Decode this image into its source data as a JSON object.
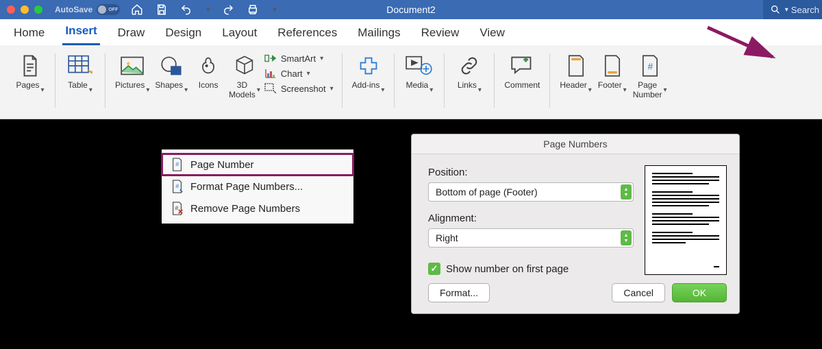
{
  "titlebar": {
    "autosave_label": "AutoSave",
    "autosave_state": "OFF",
    "doc_title": "Document2",
    "search_placeholder": "Search"
  },
  "tabs": [
    "Home",
    "Insert",
    "Draw",
    "Design",
    "Layout",
    "References",
    "Mailings",
    "Review",
    "View"
  ],
  "active_tab": "Insert",
  "ribbon": {
    "pages": "Pages",
    "table": "Table",
    "pictures": "Pictures",
    "shapes": "Shapes",
    "icons": "Icons",
    "models3d": "3D\nModels",
    "smartart": "SmartArt",
    "chart": "Chart",
    "screenshot": "Screenshot",
    "addins": "Add-ins",
    "media": "Media",
    "links": "Links",
    "comment": "Comment",
    "header": "Header",
    "footer": "Footer",
    "page_number": "Page\nNumber"
  },
  "menu": {
    "page_number": "Page Number",
    "format": "Format Page Numbers...",
    "remove": "Remove Page Numbers"
  },
  "dialog": {
    "title": "Page Numbers",
    "position_label": "Position:",
    "position_value": "Bottom of page (Footer)",
    "alignment_label": "Alignment:",
    "alignment_value": "Right",
    "show_first_label": "Show number on first page",
    "format_btn": "Format...",
    "cancel_btn": "Cancel",
    "ok_btn": "OK"
  },
  "colors": {
    "brand_blue": "#185abd",
    "highlight": "#8b1a62",
    "green": "#5fba47"
  }
}
